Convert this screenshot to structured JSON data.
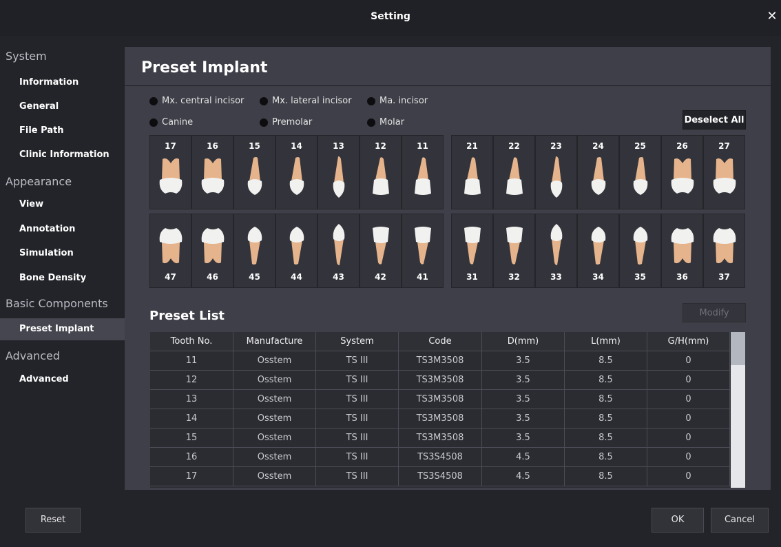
{
  "window": {
    "title": "Setting",
    "close_icon": "close-icon"
  },
  "sidebar": {
    "sections": [
      {
        "label": "System",
        "items": [
          "Information",
          "General",
          "File Path",
          "Clinic Information"
        ]
      },
      {
        "label": "Appearance",
        "items": [
          "View",
          "Annotation",
          "Simulation",
          "Bone Density"
        ]
      },
      {
        "label": "Basic Components",
        "items": [
          "Preset Implant"
        ]
      },
      {
        "label": "Advanced",
        "items": [
          "Advanced"
        ]
      }
    ],
    "active_item": "Preset Implant"
  },
  "main": {
    "page_title": "Preset Implant",
    "filters": [
      "Mx. central incisor",
      "Mx. lateral incisor",
      "Ma. incisor",
      "Canine",
      "Premolar",
      "Molar"
    ],
    "deselect_all": "Deselect All",
    "upper_teeth": [
      "17",
      "16",
      "15",
      "14",
      "13",
      "12",
      "11",
      "21",
      "22",
      "23",
      "24",
      "25",
      "26",
      "27"
    ],
    "lower_teeth": [
      "47",
      "46",
      "45",
      "44",
      "43",
      "42",
      "41",
      "31",
      "32",
      "33",
      "34",
      "35",
      "36",
      "37"
    ],
    "preset_list_title": "Preset List",
    "modify_label": "Modify",
    "table": {
      "columns": [
        "Tooth No.",
        "Manufacture",
        "System",
        "Code",
        "D(mm)",
        "L(mm)",
        "G/H(mm)"
      ],
      "rows": [
        [
          "11",
          "Osstem",
          "TS III",
          "TS3M3508",
          "3.5",
          "8.5",
          "0"
        ],
        [
          "12",
          "Osstem",
          "TS III",
          "TS3M3508",
          "3.5",
          "8.5",
          "0"
        ],
        [
          "13",
          "Osstem",
          "TS III",
          "TS3M3508",
          "3.5",
          "8.5",
          "0"
        ],
        [
          "14",
          "Osstem",
          "TS III",
          "TS3M3508",
          "3.5",
          "8.5",
          "0"
        ],
        [
          "15",
          "Osstem",
          "TS III",
          "TS3M3508",
          "3.5",
          "8.5",
          "0"
        ],
        [
          "16",
          "Osstem",
          "TS III",
          "TS3S4508",
          "4.5",
          "8.5",
          "0"
        ],
        [
          "17",
          "Osstem",
          "TS III",
          "TS3S4508",
          "4.5",
          "8.5",
          "0"
        ]
      ]
    }
  },
  "footer": {
    "reset_label": "Reset",
    "ok_label": "OK",
    "cancel_label": "Cancel"
  },
  "colors": {
    "background": "#232429",
    "panel": "#3e3f48",
    "tooth_crown": "#f1f1ef",
    "tooth_root": "#e6b48c"
  }
}
